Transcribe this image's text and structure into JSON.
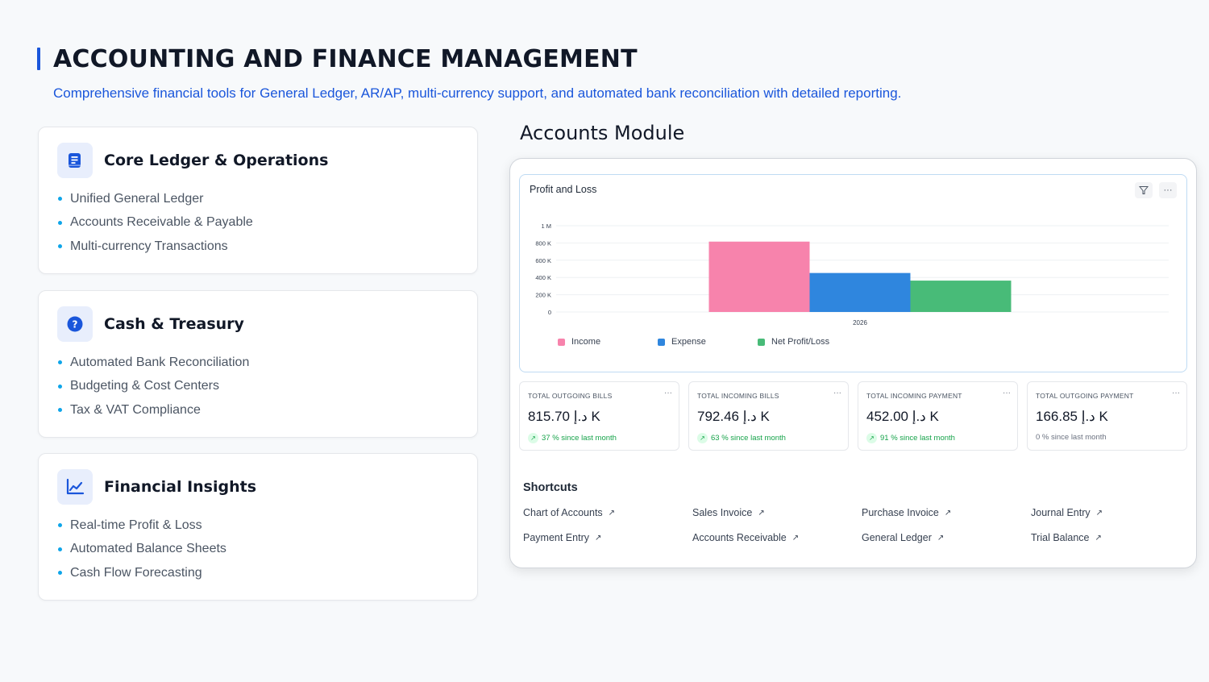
{
  "header": {
    "title": "ACCOUNTING AND FINANCE MANAGEMENT",
    "subtitle": "Comprehensive financial tools for General Ledger, AR/AP, multi-currency support, and automated bank reconciliation with detailed reporting."
  },
  "features": [
    {
      "title": "Core Ledger & Operations",
      "icon": "book-icon",
      "items": [
        "Unified General Ledger",
        "Accounts Receivable & Payable",
        "Multi-currency Transactions"
      ]
    },
    {
      "title": "Cash & Treasury",
      "icon": "question-circle-icon",
      "items": [
        "Automated Bank Reconciliation",
        "Budgeting & Cost Centers",
        "Tax & VAT Compliance"
      ]
    },
    {
      "title": "Financial Insights",
      "icon": "line-chart-icon",
      "items": [
        "Real-time Profit & Loss",
        "Automated Balance Sheets",
        "Cash Flow Forecasting"
      ]
    }
  ],
  "module_label": "Accounts Module",
  "chart": {
    "title": "Profit and Loss",
    "filter_icon": "filter-icon",
    "more_icon": "more-icon",
    "more_glyph": "···"
  },
  "chart_data": {
    "type": "bar",
    "categories": [
      "2026"
    ],
    "series": [
      {
        "name": "Income",
        "values": [
          815700
        ],
        "color": "#f783ac"
      },
      {
        "name": "Expense",
        "values": [
          452000
        ],
        "color": "#2f86de"
      },
      {
        "name": "Net Profit/Loss",
        "values": [
          363700
        ],
        "color": "#48bb78"
      }
    ],
    "y_ticks": [
      "0",
      "200 K",
      "400 K",
      "600 K",
      "800 K",
      "1 M"
    ],
    "ylim": [
      0,
      1000000
    ],
    "legend_position": "bottom-left",
    "grid": true
  },
  "stats": [
    {
      "label": "TOTAL OUTGOING BILLS",
      "value": "815.70 د.إ K",
      "change": "37 % since last month",
      "trend": "up"
    },
    {
      "label": "TOTAL INCOMING BILLS",
      "value": "792.46 د.إ K",
      "change": "63 % since last month",
      "trend": "up"
    },
    {
      "label": "TOTAL INCOMING PAYMENT",
      "value": "452.00 د.إ K",
      "change": "91 % since last month",
      "trend": "up"
    },
    {
      "label": "TOTAL OUTGOING PAYMENT",
      "value": "166.85 د.إ K",
      "change": "0 % since last month",
      "trend": "none"
    }
  ],
  "stat_more_glyph": "···",
  "trend_up_glyph": "↗",
  "shortcuts": {
    "title": "Shortcuts",
    "arrow_glyph": "↗",
    "items": [
      "Chart of Accounts",
      "Sales Invoice",
      "Purchase Invoice",
      "Journal Entry",
      "Payment Entry",
      "Accounts Receivable",
      "General Ledger",
      "Trial Balance"
    ]
  },
  "colors": {
    "accent": "#1a56db",
    "bullet": "#0ea5e9",
    "trend_up": "#16a34a"
  }
}
